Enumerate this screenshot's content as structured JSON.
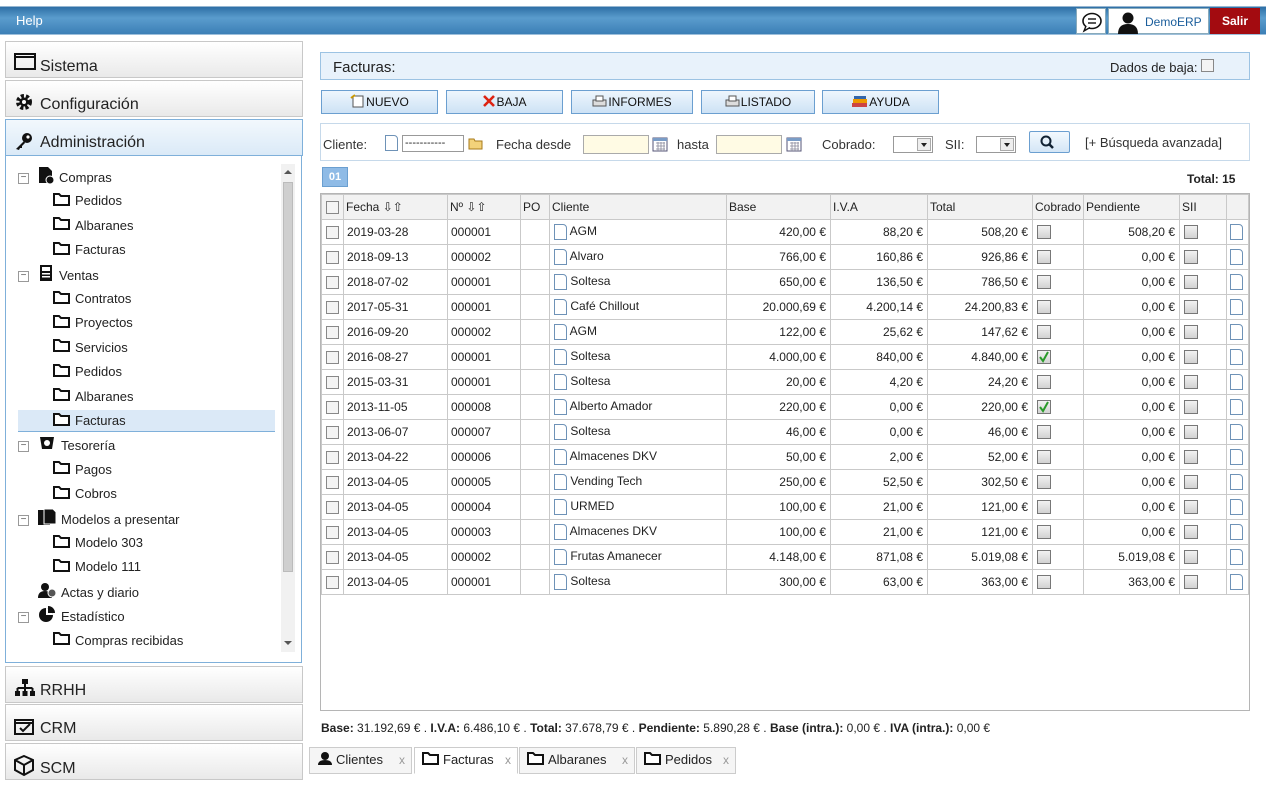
{
  "topbar": {
    "help": "Help",
    "user": "DemoERP",
    "logout": "Salir"
  },
  "sidebar": {
    "sections": [
      "Sistema",
      "Configuración",
      "Administración",
      "RRHH",
      "CRM",
      "SCM"
    ],
    "tree": [
      {
        "label": "Compras",
        "level": 0,
        "icon": "purchases-icon"
      },
      {
        "label": "Pedidos",
        "level": 1
      },
      {
        "label": "Albaranes",
        "level": 1
      },
      {
        "label": "Facturas",
        "level": 1
      },
      {
        "label": "Ventas",
        "level": 0,
        "icon": "sales-icon"
      },
      {
        "label": "Contratos",
        "level": 1
      },
      {
        "label": "Proyectos",
        "level": 1
      },
      {
        "label": "Servicios",
        "level": 1
      },
      {
        "label": "Pedidos",
        "level": 1
      },
      {
        "label": "Albaranes",
        "level": 1
      },
      {
        "label": "Facturas",
        "level": 1,
        "selected": true
      },
      {
        "label": "Tesorería",
        "level": 0,
        "icon": "treasury-icon"
      },
      {
        "label": "Pagos",
        "level": 1
      },
      {
        "label": "Cobros",
        "level": 1
      },
      {
        "label": "Modelos a presentar",
        "level": 0,
        "icon": "forms-icon"
      },
      {
        "label": "Modelo 303",
        "level": 1
      },
      {
        "label": "Modelo 111",
        "level": 1
      },
      {
        "label": "Actas y diario",
        "level": 0,
        "icon": "journal-icon"
      },
      {
        "label": "Estadístico",
        "level": 0,
        "icon": "stats-icon"
      },
      {
        "label": "Compras recibidas",
        "level": 1
      }
    ]
  },
  "main": {
    "title": "Facturas:",
    "dados_baja": "Dados de baja:",
    "buttons": [
      "NUEVO",
      "BAJA",
      "INFORMES",
      "LISTADO",
      "AYUDA"
    ],
    "filters": {
      "cliente": "Cliente:",
      "cliente_value": "-----------",
      "fecha_desde": "Fecha desde",
      "hasta": "hasta",
      "cobrado": "Cobrado:",
      "sii": "SII:",
      "advanced": "[+ Búsqueda avanzada]"
    },
    "page": "01",
    "total": "Total: 15",
    "columns": [
      "Fecha",
      "Nº",
      "PO",
      "Cliente",
      "Base",
      "I.V.A",
      "Total",
      "Cobrado",
      "Pendiente",
      "SII"
    ],
    "rows": [
      [
        "2019-03-28",
        "000001",
        "",
        "AGM",
        "420,00 €",
        "88,20 €",
        "508,20 €",
        false,
        "508,20 €"
      ],
      [
        "2018-09-13",
        "000002",
        "",
        "Alvaro",
        "766,00 €",
        "160,86 €",
        "926,86 €",
        false,
        "0,00 €"
      ],
      [
        "2018-07-02",
        "000001",
        "",
        "Soltesa",
        "650,00 €",
        "136,50 €",
        "786,50 €",
        false,
        "0,00 €"
      ],
      [
        "2017-05-31",
        "000001",
        "",
        "Café Chillout",
        "20.000,69 €",
        "4.200,14 €",
        "24.200,83 €",
        false,
        "0,00 €"
      ],
      [
        "2016-09-20",
        "000002",
        "",
        "AGM",
        "122,00 €",
        "25,62 €",
        "147,62 €",
        false,
        "0,00 €"
      ],
      [
        "2016-08-27",
        "000001",
        "",
        "Soltesa",
        "4.000,00 €",
        "840,00 €",
        "4.840,00 €",
        true,
        "0,00 €"
      ],
      [
        "2015-03-31",
        "000001",
        "",
        "Soltesa",
        "20,00 €",
        "4,20 €",
        "24,20 €",
        false,
        "0,00 €"
      ],
      [
        "2013-11-05",
        "000008",
        "",
        "Alberto Amador",
        "220,00 €",
        "0,00 €",
        "220,00 €",
        true,
        "0,00 €"
      ],
      [
        "2013-06-07",
        "000007",
        "",
        "Soltesa",
        "46,00 €",
        "0,00 €",
        "46,00 €",
        false,
        "0,00 €"
      ],
      [
        "2013-04-22",
        "000006",
        "",
        "Almacenes DKV",
        "50,00 €",
        "2,00 €",
        "52,00 €",
        false,
        "0,00 €"
      ],
      [
        "2013-04-05",
        "000005",
        "",
        "Vending Tech",
        "250,00 €",
        "52,50 €",
        "302,50 €",
        false,
        "0,00 €"
      ],
      [
        "2013-04-05",
        "000004",
        "",
        "URMED",
        "100,00 €",
        "21,00 €",
        "121,00 €",
        false,
        "0,00 €"
      ],
      [
        "2013-04-05",
        "000003",
        "",
        "Almacenes DKV",
        "100,00 €",
        "21,00 €",
        "121,00 €",
        false,
        "0,00 €"
      ],
      [
        "2013-04-05",
        "000002",
        "",
        "Frutas Amanecer",
        "4.148,00 €",
        "871,08 €",
        "5.019,08 €",
        false,
        "5.019,08 €"
      ],
      [
        "2013-04-05",
        "000001",
        "",
        "Soltesa",
        "300,00 €",
        "63,00 €",
        "363,00 €",
        false,
        "363,00 €"
      ]
    ],
    "totals": [
      {
        "k": "Base:",
        "v": " 31.192,69 € . "
      },
      {
        "k": "I.V.A:",
        "v": " 6.486,10 € . "
      },
      {
        "k": "Total:",
        "v": " 37.678,79 € . "
      },
      {
        "k": "Pendiente:",
        "v": " 5.890,28 € . "
      },
      {
        "k": "Base (intra.):",
        "v": " 0,00 € . "
      },
      {
        "k": "IVA (intra.):",
        "v": " 0,00 €"
      }
    ]
  },
  "tabs": [
    "Clientes",
    "Facturas",
    "Albaranes",
    "Pedidos"
  ]
}
